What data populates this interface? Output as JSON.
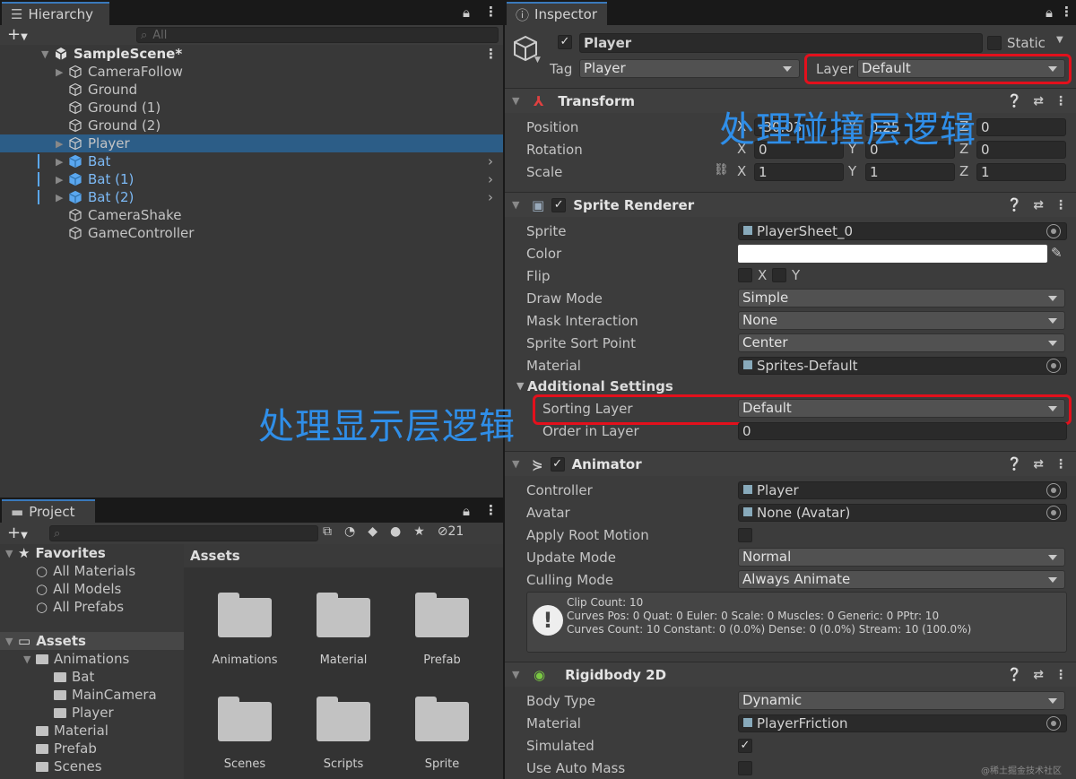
{
  "hierarchy": {
    "tab": "Hierarchy",
    "search_placeholder": "All",
    "scene": "SampleScene*",
    "items": [
      {
        "label": "CameraFollow",
        "expandable": true,
        "blue": false
      },
      {
        "label": "Ground",
        "expandable": false,
        "blue": false
      },
      {
        "label": "Ground (1)",
        "expandable": false,
        "blue": false
      },
      {
        "label": "Ground (2)",
        "expandable": false,
        "blue": false
      },
      {
        "label": "Player",
        "expandable": true,
        "blue": false,
        "selected": true
      },
      {
        "label": "Bat",
        "expandable": true,
        "blue": true
      },
      {
        "label": "Bat (1)",
        "expandable": true,
        "blue": true
      },
      {
        "label": "Bat (2)",
        "expandable": true,
        "blue": true
      },
      {
        "label": "CameraShake",
        "expandable": false,
        "blue": false
      },
      {
        "label": "GameController",
        "expandable": false,
        "blue": false
      }
    ]
  },
  "project": {
    "tab": "Project",
    "hidden_count": "21",
    "favorites_label": "Favorites",
    "favorites": [
      "All Materials",
      "All Models",
      "All Prefabs"
    ],
    "assets_label": "Assets",
    "tree": [
      "Animations",
      "Bat",
      "MainCamera",
      "Player",
      "Material",
      "Prefab",
      "Scenes"
    ],
    "breadcrumb": "Assets",
    "folders": [
      "Animations",
      "Material",
      "Prefab",
      "Scenes",
      "Scripts",
      "Sprite"
    ]
  },
  "inspector": {
    "tab": "Inspector",
    "name": "Player",
    "static_label": "Static",
    "tag_label": "Tag",
    "tag_value": "Player",
    "layer_label": "Layer",
    "layer_value": "Default",
    "transform": {
      "title": "Transform",
      "position_label": "Position",
      "rotation_label": "Rotation",
      "scale_label": "Scale",
      "position": [
        "-30.03",
        "0.25",
        "0"
      ],
      "rotation": [
        "0",
        "0",
        "0"
      ],
      "scale": [
        "1",
        "1",
        "1"
      ],
      "axes": [
        "X",
        "Y",
        "Z"
      ]
    },
    "sprite_renderer": {
      "title": "Sprite Renderer",
      "rows": [
        {
          "label": "Sprite",
          "value": "PlayerSheet_0"
        },
        {
          "label": "Color",
          "value": ""
        },
        {
          "label": "Flip",
          "value": ""
        },
        {
          "label": "Draw Mode",
          "value": "Simple"
        },
        {
          "label": "Mask Interaction",
          "value": "None"
        },
        {
          "label": "Sprite Sort Point",
          "value": "Center"
        },
        {
          "label": "Material",
          "value": "Sprites-Default"
        }
      ],
      "flip_x": "X",
      "flip_y": "Y",
      "additional_settings": "Additional Settings",
      "sorting_layer_label": "Sorting Layer",
      "sorting_layer_value": "Default",
      "order_label": "Order in Layer",
      "order_value": "0"
    },
    "animator": {
      "title": "Animator",
      "rows": [
        {
          "label": "Controller",
          "value": "Player"
        },
        {
          "label": "Avatar",
          "value": "None (Avatar)"
        },
        {
          "label": "Apply Root Motion",
          "value": ""
        },
        {
          "label": "Update Mode",
          "value": "Normal"
        },
        {
          "label": "Culling Mode",
          "value": "Always Animate"
        }
      ],
      "info": [
        "Clip Count: 10",
        "Curves Pos: 0 Quat: 0 Euler: 0 Scale: 0 Muscles: 0 Generic: 0 PPtr: 10",
        "Curves Count: 10 Constant: 0 (0.0%) Dense: 0 (0.0%) Stream: 10 (100.0%)"
      ]
    },
    "rigidbody": {
      "title": "Rigidbody 2D",
      "rows": [
        {
          "label": "Body Type",
          "value": "Dynamic"
        },
        {
          "label": "Material",
          "value": "PlayerFriction"
        },
        {
          "label": "Simulated",
          "value": ""
        },
        {
          "label": "Use Auto Mass",
          "value": ""
        }
      ]
    }
  },
  "annotations": {
    "collision": "处理碰撞层逻辑",
    "display": "处理显示层逻辑"
  },
  "watermark": "@稀土掘金技术社区",
  "colors": {
    "annotation": "#2f8ee8",
    "highlight": "#e3101c",
    "selection": "#2c5d87",
    "prefab_blue": "#7cb9f5"
  }
}
